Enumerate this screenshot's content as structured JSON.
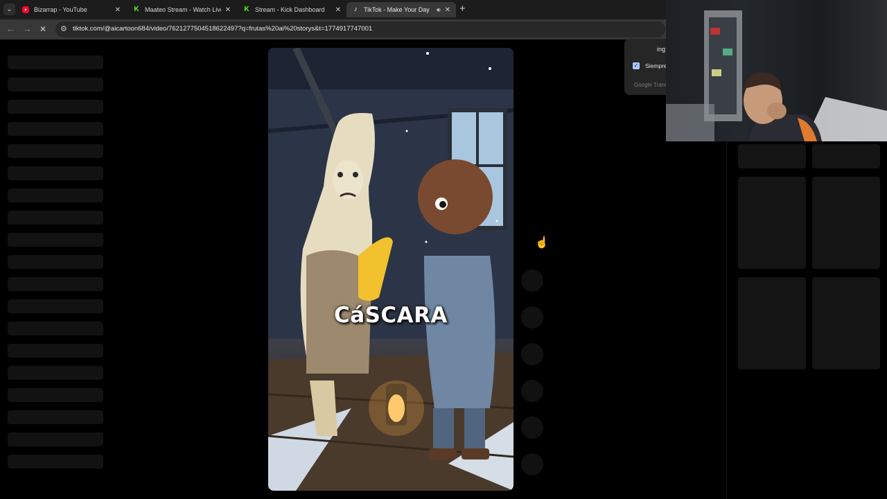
{
  "browser": {
    "tabs": [
      {
        "title": "Bizarrap - YouTube",
        "favicon": "youtube-icon",
        "active": false
      },
      {
        "title": "Maateo Stream - Watch Live on",
        "favicon": "kick-icon",
        "active": false
      },
      {
        "title": "Stream - Kick Dashboard",
        "favicon": "kick-icon",
        "active": false
      },
      {
        "title": "TikTok - Make Your Day",
        "favicon": "tiktok-icon",
        "active": true
      }
    ],
    "url": "tiktok.com/@aicartoon684/video/7621277504518622497?q=frutas%20ai%20storys&t=1774917747001"
  },
  "video": {
    "caption": "CáSCARA"
  },
  "translate_popup": {
    "lang_fragment": "ing",
    "checkbox_label": "Siempre",
    "checked": true,
    "footer": "Google Trans"
  },
  "colors": {
    "tab_strip": "#1c1c1c",
    "toolbar": "#383838",
    "page_bg": "#000000",
    "skeleton": "#121212",
    "youtube": "#ff0033",
    "kick": "#53fc18"
  }
}
